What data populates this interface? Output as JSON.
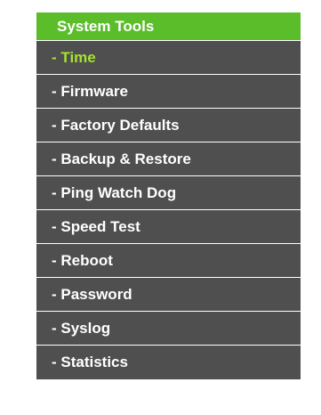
{
  "menu": {
    "header": "System Tools",
    "items": [
      {
        "label": "- Time",
        "selected": true
      },
      {
        "label": "- Firmware",
        "selected": false
      },
      {
        "label": "- Factory Defaults",
        "selected": false
      },
      {
        "label": "- Backup & Restore",
        "selected": false
      },
      {
        "label": "- Ping Watch Dog",
        "selected": false
      },
      {
        "label": "- Speed Test",
        "selected": false
      },
      {
        "label": "- Reboot",
        "selected": false
      },
      {
        "label": "- Password",
        "selected": false
      },
      {
        "label": "- Syslog",
        "selected": false
      },
      {
        "label": "- Statistics",
        "selected": false
      }
    ]
  },
  "colors": {
    "header_bg": "#5bbd2a",
    "item_bg": "#4f4f4f",
    "item_text": "#ffffff",
    "selected_text": "#a6e22e"
  }
}
